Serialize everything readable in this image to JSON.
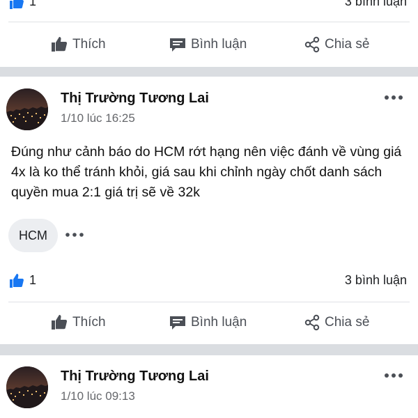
{
  "top_post": {
    "like_count": "1",
    "comments": "3 bình luận",
    "actions": {
      "like": "Thích",
      "comment": "Bình luận",
      "share": "Chia sẻ"
    }
  },
  "post1": {
    "author": "Thị Trường Tương Lai",
    "time": "1/10 lúc 16:25",
    "text": "Đúng như cảnh báo do HCM rớt hạng nên việc đánh về vùng giá 4x là ko thể tránh khỏi, giá sau khi chỉnh ngày chốt danh sách quyền mua 2:1 giá trị sẽ về 32k",
    "hashtag": "HCM",
    "like_count": "1",
    "comments": "3 bình luận",
    "actions": {
      "like": "Thích",
      "comment": "Bình luận",
      "share": "Chia sẻ"
    }
  },
  "post2": {
    "author": "Thị Trường Tương Lai",
    "time": "1/10 lúc 09:13"
  },
  "icons": {
    "like": "thumbs-up-icon",
    "comment": "speech-bubble-icon",
    "share": "share-icon",
    "more": "ellipsis-icon"
  },
  "colors": {
    "like_blue": "#1877f2",
    "action_gray": "#4b4f56",
    "separator": "#dadde1"
  }
}
